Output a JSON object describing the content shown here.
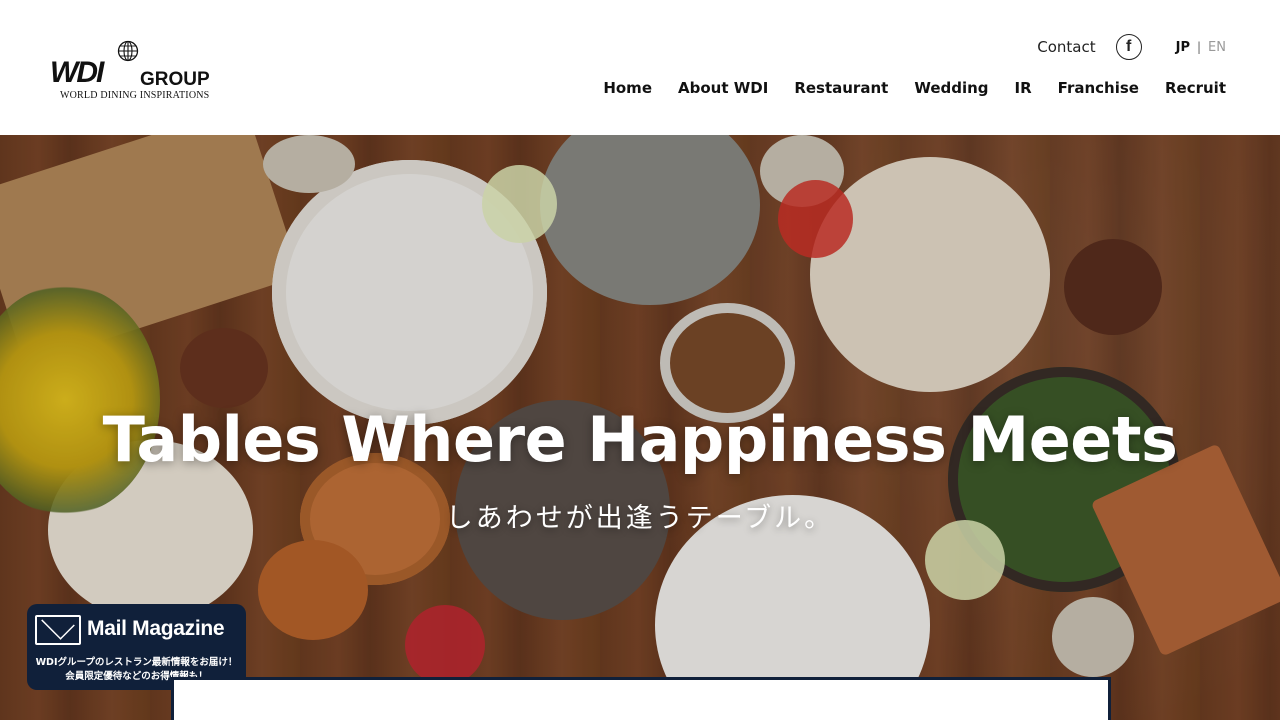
{
  "brand": {
    "logo_mark": "WDI",
    "logo_group": "GROUP",
    "tagline": "WORLD DINING INSPIRATIONS"
  },
  "utility": {
    "contact_label": "Contact",
    "facebook_icon": "facebook-icon",
    "lang_jp": "JP",
    "lang_separator": "|",
    "lang_en": "EN"
  },
  "nav": {
    "items": [
      {
        "label": "Home"
      },
      {
        "label": "About WDI"
      },
      {
        "label": "Restaurant"
      },
      {
        "label": "Wedding"
      },
      {
        "label": "IR"
      },
      {
        "label": "Franchise"
      },
      {
        "label": "Recruit"
      }
    ]
  },
  "hero": {
    "headline": "Tables Where Happiness Meets",
    "subheadline": "しあわせが出逢うテーブル。"
  },
  "mail_magazine": {
    "title": "Mail Magazine",
    "line1": "WDIグループのレストラン最新情報をお届け！",
    "line2": "会員限定優待などのお得情報も！"
  },
  "colors": {
    "navy": "#10203a",
    "wood": "#6e3f22"
  }
}
